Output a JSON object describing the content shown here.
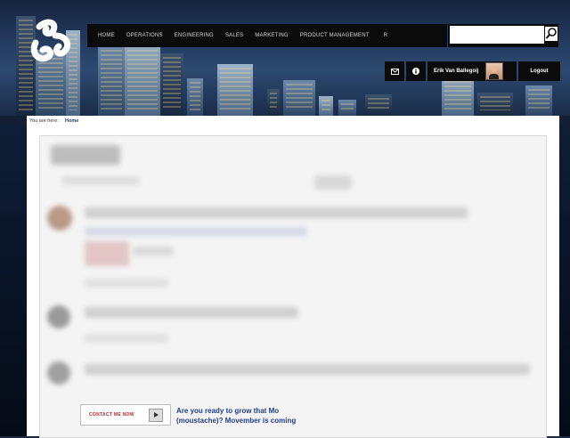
{
  "nav": {
    "items": [
      {
        "label": "HOME"
      },
      {
        "label": "OPERATIONS"
      },
      {
        "label": "ENGINEERING"
      },
      {
        "label": "SALES"
      },
      {
        "label": "MARKETING"
      },
      {
        "label": "PRODUCT MANAGEMENT"
      }
    ],
    "more": "R"
  },
  "search": {
    "value": "",
    "icon": "search-icon"
  },
  "userbar": {
    "mail_icon": "mail-icon",
    "info_icon": "info-icon",
    "user_name": "Erik Van Ballegoij",
    "logout_label": "Logout"
  },
  "breadcrumb": {
    "label": "You are here:",
    "current": "Home"
  },
  "ad": {
    "button_label": "CONTACT ME NOW",
    "text": "Are you ready to grow that Mo (moustache)? Movember is coming"
  },
  "colors": {
    "nav_bg": "#0b0b0b",
    "link": "#1f3d8a",
    "accent_red": "#b02a2a"
  }
}
